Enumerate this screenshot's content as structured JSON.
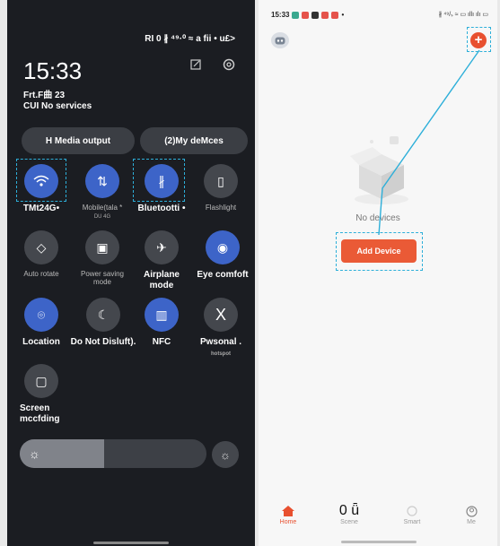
{
  "left": {
    "status": "RI 0 ∦ ⁴⁹·⁰ ≈ a fii • u£>",
    "clock": "15:33",
    "date": "Frt.F曲 23",
    "no_services": "CUI No services",
    "media_output": "H Media output",
    "my_devices": "(2)My deMces",
    "tiles": [
      {
        "label": "TMt24G•",
        "sub": "",
        "icon": "wifi-icon",
        "on": true,
        "big": true
      },
      {
        "label": "Mobile(tala *",
        "sub": "DU 4G",
        "icon": "mobile-data-icon",
        "on": true,
        "big": false
      },
      {
        "label": "Bluetootti •",
        "sub": "",
        "icon": "bluetooth-icon",
        "on": true,
        "big": true
      },
      {
        "label": "Flashlight",
        "sub": "",
        "icon": "flashlight-icon",
        "on": false,
        "big": false
      },
      {
        "label": "Auto rotate",
        "sub": "",
        "icon": "rotate-icon",
        "on": false,
        "big": false
      },
      {
        "label": "Power saving mode",
        "sub": "",
        "icon": "battery-icon",
        "on": false,
        "big": false
      },
      {
        "label": "Airplane mode",
        "sub": "",
        "icon": "airplane-icon",
        "on": false,
        "big": true
      },
      {
        "label": "Eye comfoft",
        "sub": "",
        "icon": "eye-icon",
        "on": true,
        "big": true
      },
      {
        "label": "Location",
        "sub": "",
        "icon": "location-icon",
        "on": true,
        "big": true
      },
      {
        "label": "Do Not Disluft).",
        "sub": "",
        "icon": "moon-icon",
        "on": false,
        "big": true
      },
      {
        "label": "NFC",
        "sub": "",
        "icon": "nfc-icon",
        "on": true,
        "big": true
      },
      {
        "label": "Pwsonal .",
        "sub": "hotspot",
        "icon": "hotspot-icon",
        "on": false,
        "big": true
      },
      {
        "label": "Screen mccfding",
        "sub": "",
        "icon": "screen-record-icon",
        "on": false,
        "big": true
      }
    ],
    "brightness_level": 0.45,
    "hotspot_glyph": "X"
  },
  "right": {
    "status_time": "15:33",
    "status_icons": "∦ ⁴⁹/ₛ ≈ ▭ ıllı ılı ▭",
    "add_glyph": "+",
    "no_devices": "No devices",
    "add_device": "Add Device",
    "tabs": [
      {
        "label": "Home",
        "icon": "home-icon",
        "active": true
      },
      {
        "label": "Scene",
        "icon": "scene-icon",
        "active": false,
        "overlay": "0 ǖ"
      },
      {
        "label": "Smart",
        "icon": "smart-icon",
        "active": false
      },
      {
        "label": "Me",
        "icon": "me-icon",
        "active": false
      }
    ]
  },
  "colors": {
    "accent_blue": "#3d64c8",
    "highlight": "#2dafd9",
    "brand_orange": "#ea5a36"
  }
}
